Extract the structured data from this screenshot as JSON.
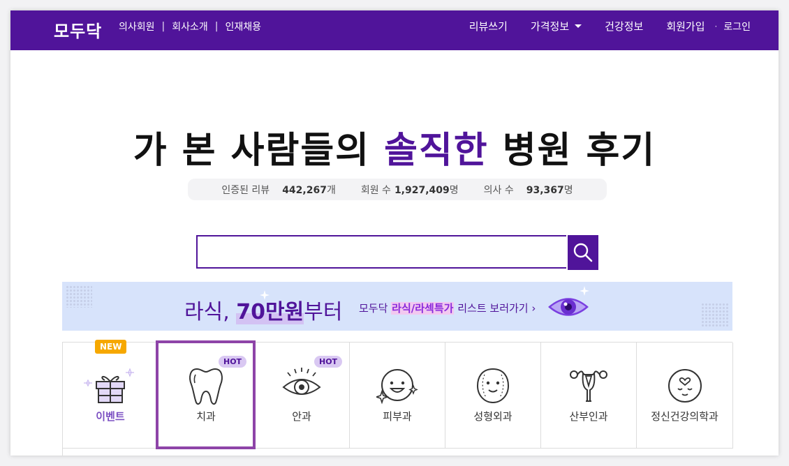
{
  "colors": {
    "brand_purple": "#50149a",
    "hot_badge_bg": "#d9c8f2",
    "new_badge_bg": "#f6a800",
    "banner_bg": "#d7e3fb",
    "selection_outline": "#8e44a8"
  },
  "header": {
    "logo": "모두닥",
    "left_links": [
      "의사회원",
      "회사소개",
      "인재채용"
    ],
    "separator": "|",
    "right_links": {
      "review": "리뷰쓰기",
      "price": "가격정보",
      "health": "건강정보",
      "signup": "회원가입",
      "dot": "·",
      "login": "로그인"
    },
    "price_dropdown_icon": "caret-down-icon"
  },
  "hero": {
    "title_pre": "가 본 사람들의 ",
    "title_accent": "솔직한",
    "title_post": " 병원 후기"
  },
  "stats": {
    "reviews_label": "인증된 리뷰",
    "reviews_value": "442,267",
    "reviews_unit": "개",
    "members_label": "회원 수",
    "members_value": "1,927,409",
    "members_unit": "명",
    "doctors_label": "의사 수",
    "doctors_value": "93,367",
    "doctors_unit": "명"
  },
  "search": {
    "placeholder": "",
    "value": "",
    "button_icon": "search-icon"
  },
  "banner": {
    "headline_pre": "라식, ",
    "headline_big": "70만원",
    "headline_post": "부터",
    "sub_pre": "모두닥 ",
    "sub_highlight": "라식/라섹특가",
    "sub_post": " 리스트 보러가기 ›",
    "icon": "eye-icon"
  },
  "categories": [
    {
      "label": "이벤트",
      "icon": "gift-icon",
      "badge": "NEW"
    },
    {
      "label": "치과",
      "icon": "tooth-icon",
      "badge": "HOT",
      "selected": true
    },
    {
      "label": "안과",
      "icon": "eye-icon",
      "badge": "HOT"
    },
    {
      "label": "피부과",
      "icon": "sparkle-face-icon",
      "badge": ""
    },
    {
      "label": "성형외과",
      "icon": "face-icon",
      "badge": ""
    },
    {
      "label": "산부인과",
      "icon": "uterus-icon",
      "badge": ""
    },
    {
      "label": "정신건강의학과",
      "icon": "heart-head-icon",
      "badge": ""
    }
  ]
}
